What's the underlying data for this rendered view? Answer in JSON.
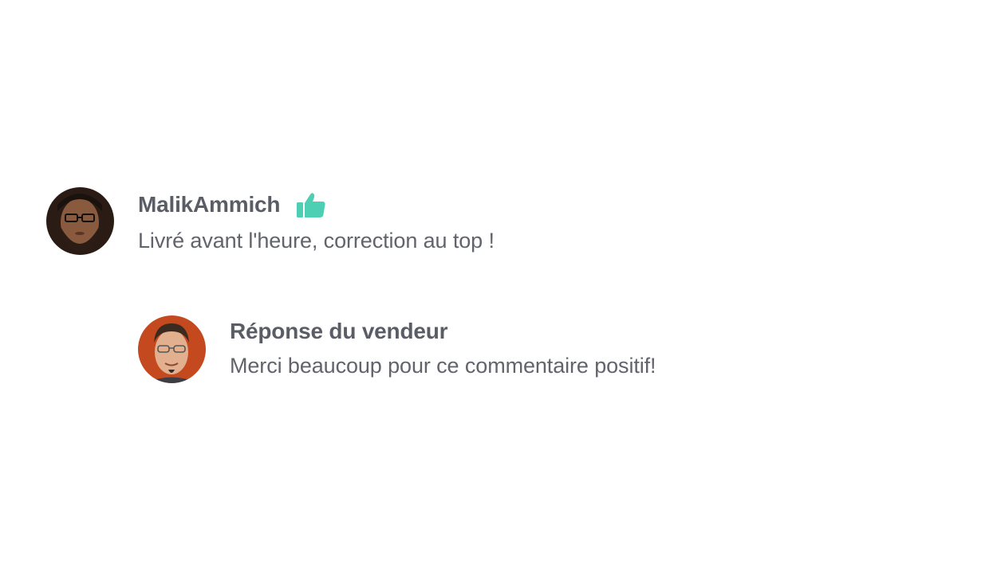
{
  "review": {
    "author": "MalikAmmich",
    "rating_icon": "thumbs-up-icon",
    "accent_color": "#4ecfb3",
    "text": "Livré avant l'heure, correction au top !"
  },
  "reply": {
    "title": "Réponse du vendeur",
    "text": "Merci beaucoup pour ce commentaire positif!"
  }
}
